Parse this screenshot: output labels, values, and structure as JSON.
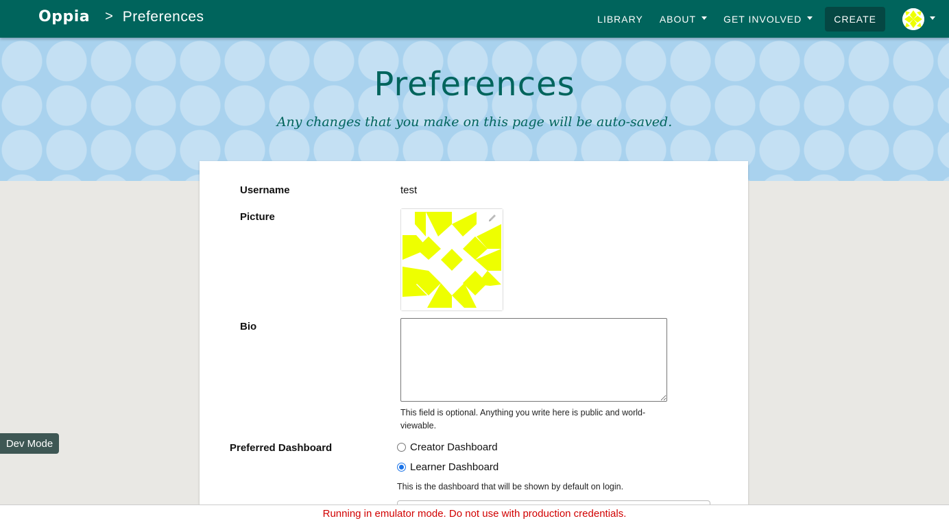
{
  "navbar": {
    "logo": "Oppia",
    "breadcrumb_separator": ">",
    "breadcrumb_title": "Preferences",
    "links": [
      {
        "label": "LIBRARY",
        "has_dropdown": false
      },
      {
        "label": "ABOUT",
        "has_dropdown": true
      },
      {
        "label": "GET INVOLVED",
        "has_dropdown": true
      }
    ],
    "create_label": "CREATE"
  },
  "banner": {
    "title": "Preferences",
    "subtitle": "Any changes that you make on this page will be auto-saved."
  },
  "form": {
    "username_label": "Username",
    "username_value": "test",
    "picture_label": "Picture",
    "bio_label": "Bio",
    "bio_value": "",
    "bio_help": "This field is optional. Anything you write here is public and world-viewable.",
    "dashboard_label": "Preferred Dashboard",
    "dashboard_options": [
      {
        "label": "Creator Dashboard",
        "checked": false
      },
      {
        "label": "Learner Dashboard",
        "checked": true
      }
    ],
    "dashboard_help": "This is the dashboard that will be shown by default on login."
  },
  "dev_mode_label": "Dev Mode",
  "emulator_notice": "Running in emulator mode. Do not use with production credentials.",
  "colors": {
    "navbar": "#00645c",
    "banner": "#a9d2ee",
    "avatar": "#eeff00",
    "radio_checked": "#1a73e8",
    "emulator_text": "#d10000"
  }
}
